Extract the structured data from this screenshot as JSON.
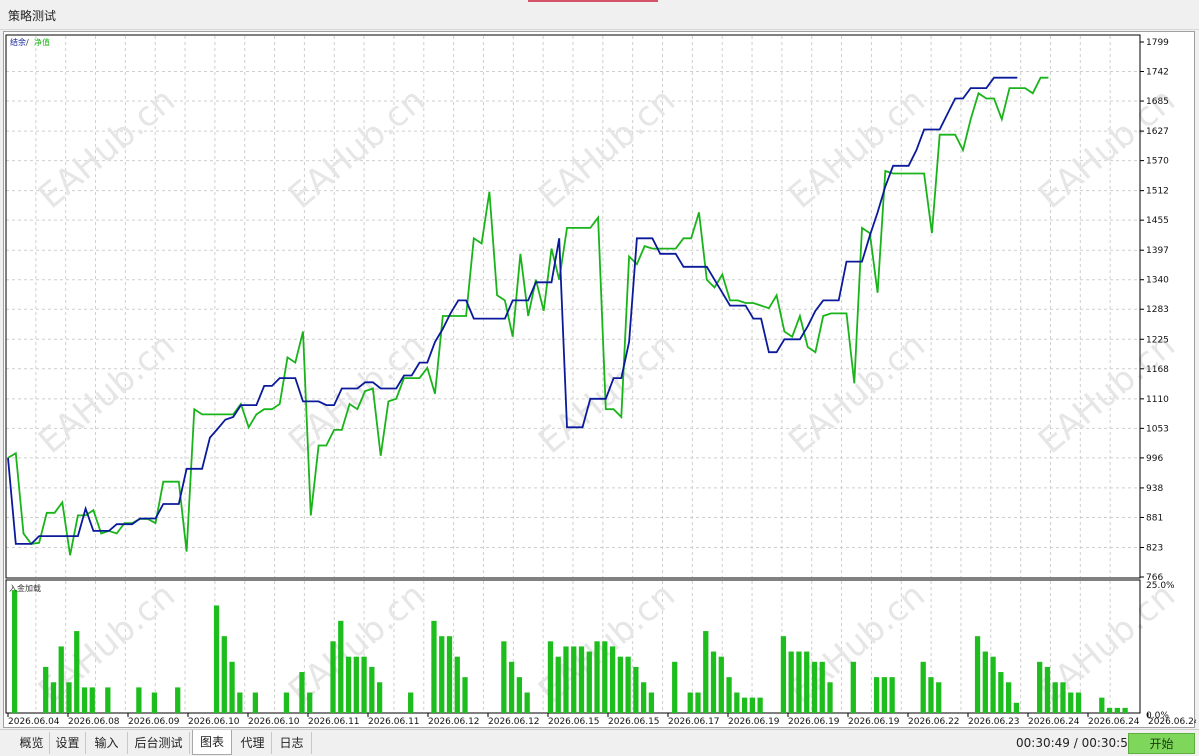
{
  "window": {
    "title": "策略测试"
  },
  "chart": {
    "main_legend": {
      "balance": "结余",
      "sep": " / ",
      "equity": "净值"
    },
    "volume_label": "入金加载",
    "x_labels": [
      "2026.06.04",
      "2026.06.08",
      "2026.06.09",
      "2026.06.10",
      "2026.06.10",
      "2026.06.11",
      "2026.06.11",
      "2026.06.12",
      "2026.06.12",
      "2026.06.15",
      "2026.06.15",
      "2026.06.17",
      "2026.06.19",
      "2026.06.19",
      "2026.06.19",
      "2026.06.22",
      "2026.06.23",
      "2026.06.24",
      "2026.06.24",
      "2026.06.24"
    ],
    "watermark": "EAHub.cn",
    "colors": {
      "balance": "#0a1a9a",
      "equity": "#19b419",
      "bars": "#1cbd1c",
      "grid": "#c8c8c8"
    }
  },
  "chart_data": [
    {
      "type": "line",
      "y_ticks": [
        1799,
        1742,
        1685,
        1627,
        1570,
        1512,
        1455,
        1397,
        1340,
        1283,
        1225,
        1168,
        1110,
        1053,
        996,
        938,
        881,
        823,
        766
      ],
      "ylim": [
        766,
        1799
      ],
      "x": [
        0,
        1,
        2,
        3,
        4,
        5,
        6,
        7,
        8,
        9,
        10,
        11,
        12,
        13,
        14,
        15,
        16,
        17,
        18,
        19,
        20,
        21,
        22,
        23,
        24,
        25,
        26,
        27,
        28,
        29,
        30,
        31,
        32,
        33,
        34,
        35,
        36,
        37,
        38,
        39,
        40,
        41,
        42,
        43,
        44,
        45,
        46,
        47,
        48,
        49,
        50,
        51,
        52,
        53,
        54,
        55,
        56,
        57,
        58,
        59,
        60,
        61,
        62,
        63,
        64,
        65,
        66,
        67,
        68,
        69,
        70,
        71,
        72,
        73,
        74,
        75,
        76,
        77,
        78,
        79,
        80,
        81,
        82,
        83,
        84,
        85,
        86,
        87,
        88,
        89,
        90,
        91,
        92,
        93,
        94,
        95,
        96,
        97,
        98,
        99,
        100,
        101,
        102,
        103,
        104,
        105,
        106,
        107,
        108,
        109,
        110,
        111,
        112,
        113,
        114,
        115,
        116,
        117,
        118,
        119,
        120,
        121,
        122,
        123,
        124,
        125,
        126,
        127,
        128,
        129,
        130,
        131,
        132,
        133,
        134,
        135,
        136,
        137,
        138,
        139,
        140,
        141,
        142,
        143,
        144
      ],
      "series": [
        {
          "name": "结余",
          "values": [
            996,
            830,
            830,
            830,
            845,
            845,
            845,
            845,
            845,
            845,
            898,
            855,
            855,
            855,
            868,
            868,
            868,
            879,
            879,
            879,
            907,
            907,
            907,
            975,
            975,
            975,
            1035,
            1052,
            1070,
            1075,
            1098,
            1098,
            1098,
            1135,
            1135,
            1150,
            1150,
            1150,
            1105,
            1105,
            1105,
            1098,
            1098,
            1130,
            1130,
            1130,
            1142,
            1142,
            1130,
            1130,
            1130,
            1155,
            1155,
            1180,
            1180,
            1220,
            1245,
            1275,
            1300,
            1300,
            1265,
            1265,
            1265,
            1265,
            1265,
            1300,
            1300,
            1300,
            1335,
            1335,
            1335,
            1420,
            1055,
            1055,
            1055,
            1110,
            1110,
            1110,
            1150,
            1150,
            1220,
            1420,
            1420,
            1420,
            1390,
            1390,
            1390,
            1365,
            1365,
            1365,
            1365,
            1340,
            1315,
            1290,
            1290,
            1290,
            1265,
            1265,
            1200,
            1200,
            1225,
            1225,
            1225,
            1250,
            1280,
            1300,
            1300,
            1300,
            1375,
            1375,
            1375,
            1425,
            1470,
            1520,
            1560,
            1560,
            1560,
            1590,
            1630,
            1630,
            1630,
            1660,
            1690,
            1690,
            1710,
            1710,
            1710,
            1730,
            1730,
            1730,
            1730
          ]
        },
        {
          "name": "净值",
          "values": [
            996,
            1005,
            850,
            830,
            832,
            890,
            890,
            910,
            808,
            885,
            885,
            895,
            850,
            855,
            850,
            870,
            870,
            878,
            878,
            870,
            950,
            950,
            950,
            815,
            1090,
            1080,
            1080,
            1080,
            1080,
            1080,
            1100,
            1055,
            1080,
            1090,
            1090,
            1100,
            1190,
            1180,
            1240,
            885,
            1020,
            1020,
            1050,
            1050,
            1100,
            1090,
            1125,
            1130,
            1000,
            1105,
            1110,
            1150,
            1150,
            1150,
            1170,
            1120,
            1270,
            1270,
            1270,
            1270,
            1420,
            1410,
            1510,
            1310,
            1300,
            1230,
            1390,
            1270,
            1340,
            1280,
            1400,
            1340,
            1440,
            1440,
            1440,
            1440,
            1460,
            1090,
            1090,
            1075,
            1385,
            1370,
            1405,
            1400,
            1400,
            1400,
            1400,
            1420,
            1420,
            1470,
            1340,
            1325,
            1350,
            1300,
            1300,
            1295,
            1295,
            1290,
            1285,
            1310,
            1240,
            1230,
            1270,
            1210,
            1200,
            1270,
            1275,
            1275,
            1275,
            1140,
            1440,
            1430,
            1315,
            1550,
            1545,
            1545,
            1545,
            1545,
            1545,
            1430,
            1620,
            1620,
            1620,
            1590,
            1650,
            1700,
            1690,
            1690,
            1650,
            1710,
            1710,
            1710,
            1700,
            1730,
            1730
          ]
        }
      ]
    },
    {
      "type": "bar",
      "y_ticks": [
        "25.0%",
        "0.0%"
      ],
      "ylim": [
        0,
        25
      ],
      "values": [
        24,
        0,
        0,
        0,
        9,
        6,
        13,
        6,
        16,
        5,
        5,
        0,
        5,
        0,
        0,
        0,
        5,
        0,
        4,
        0,
        0,
        5,
        0,
        0,
        0,
        0,
        21,
        15,
        10,
        4,
        0,
        4,
        0,
        0,
        0,
        4,
        0,
        8,
        4,
        0,
        0,
        14,
        18,
        11,
        11,
        11,
        9,
        6,
        0,
        0,
        0,
        4,
        0,
        0,
        18,
        15,
        15,
        11,
        7,
        0,
        0,
        0,
        0,
        14,
        10,
        7,
        4,
        0,
        0,
        14,
        11,
        13,
        13,
        13,
        12,
        14,
        14,
        13,
        11,
        11,
        9,
        6,
        4,
        0,
        0,
        10,
        0,
        4,
        4,
        16,
        12,
        11,
        7,
        4,
        3,
        3,
        3,
        0,
        0,
        15,
        12,
        12,
        12,
        10,
        10,
        6,
        0,
        0,
        10,
        0,
        0,
        7,
        7,
        7,
        0,
        0,
        0,
        10,
        7,
        6,
        0,
        0,
        0,
        0,
        15,
        12,
        11,
        8,
        6,
        2,
        0,
        0,
        10,
        9,
        6,
        6,
        4,
        4,
        0,
        0,
        3,
        1,
        1,
        1,
        0
      ]
    }
  ]
}
